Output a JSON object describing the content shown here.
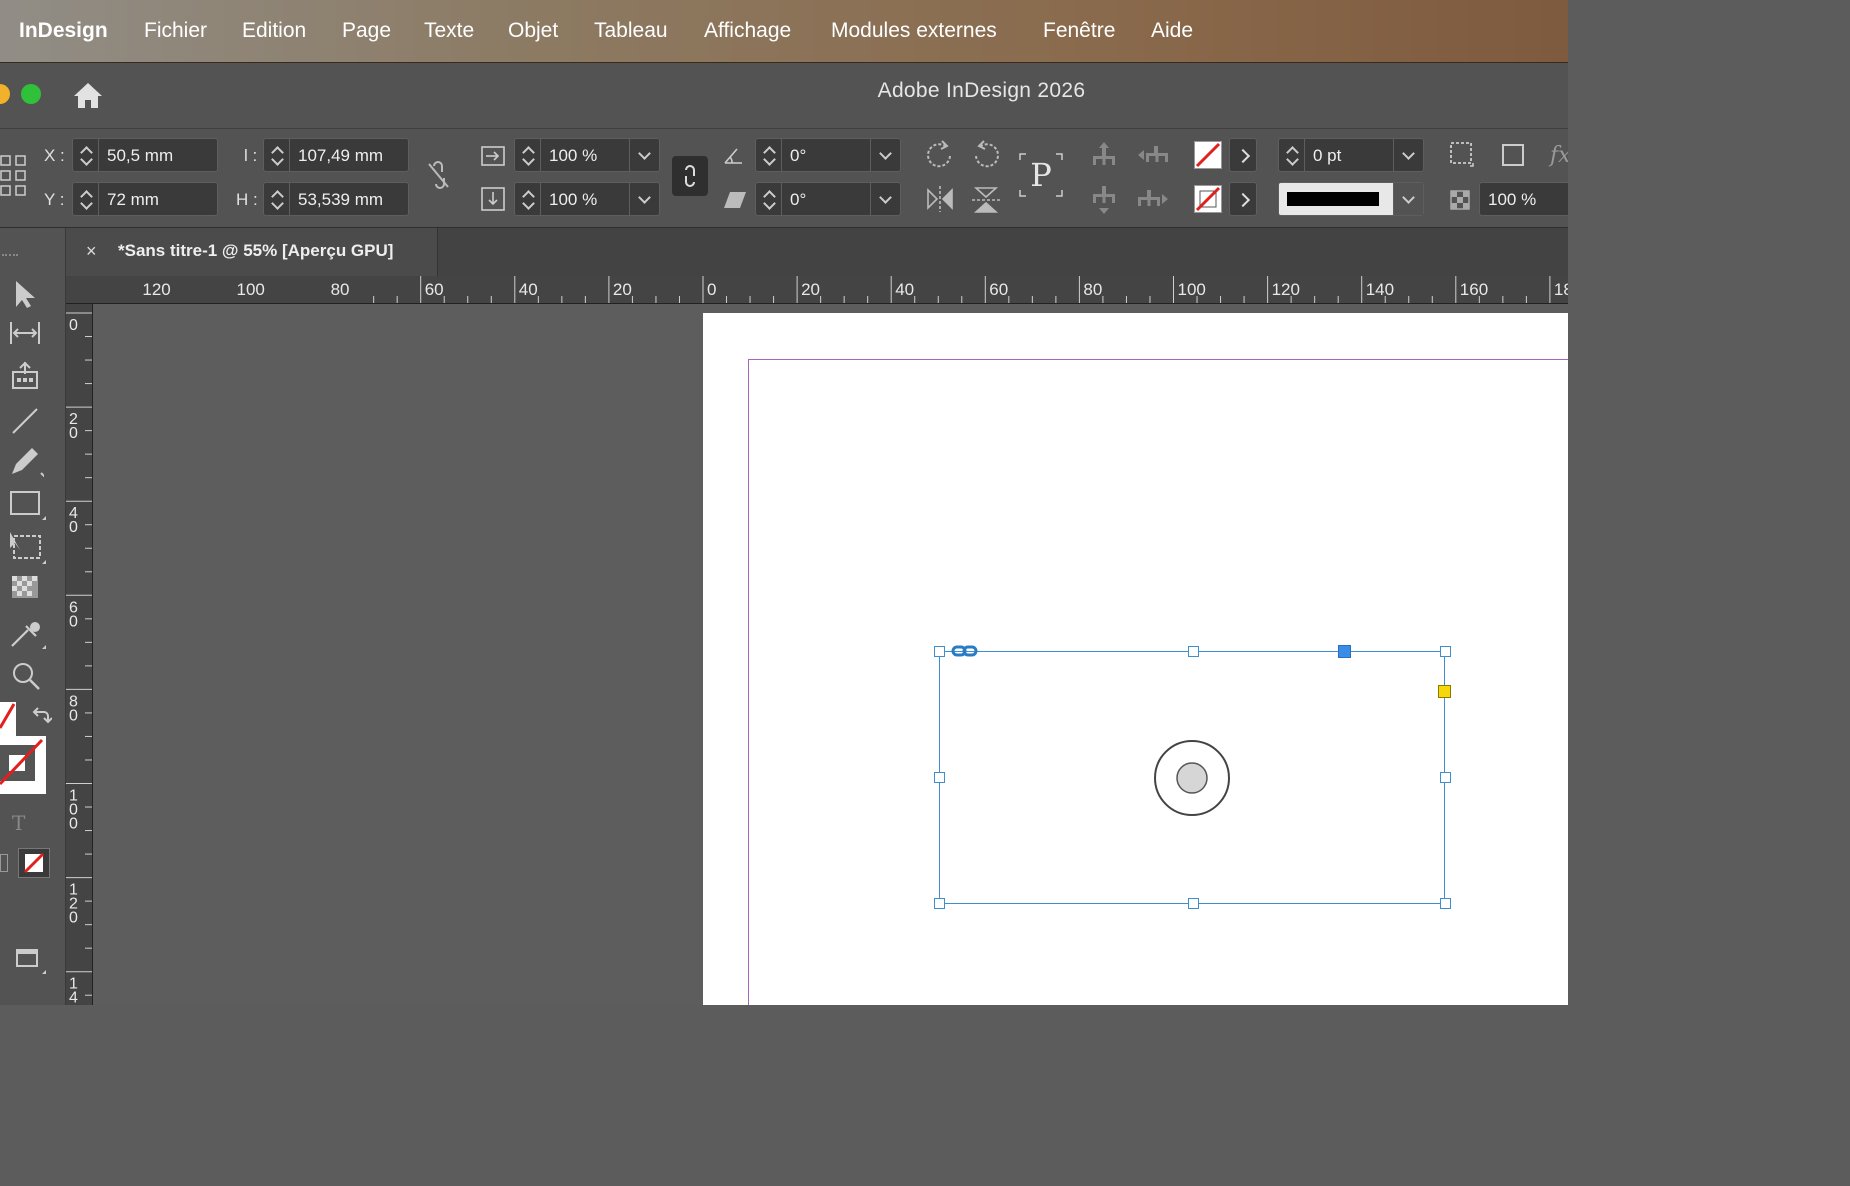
{
  "menubar": {
    "app": "InDesign",
    "items": [
      "Fichier",
      "Edition",
      "Page",
      "Texte",
      "Objet",
      "Tableau",
      "Affichage",
      "Modules externes",
      "Fenêtre",
      "Aide"
    ]
  },
  "window": {
    "title": "Adobe InDesign 2026"
  },
  "control": {
    "x_label": "X :",
    "x_value": "50,5 mm",
    "y_label": "Y :",
    "y_value": "72 mm",
    "w_label": "l :",
    "w_value": "107,49 mm",
    "h_label": "H :",
    "h_value": "53,539 mm",
    "scale_x": "100 %",
    "scale_y": "100 %",
    "rotate": "0°",
    "shear": "0°",
    "stroke_weight": "0 pt",
    "opacity": "100 %"
  },
  "document_tab": {
    "close": "×",
    "title": "*Sans titre-1 @ 55% [Aperçu GPU]"
  },
  "hruler": {
    "labels": [
      "120",
      "100",
      "80",
      "60",
      "40",
      "20",
      "0",
      "20",
      "40",
      "60",
      "80",
      "100",
      "120",
      "140",
      "160",
      "18"
    ]
  },
  "vruler": {
    "labels": [
      "0",
      "2\n0",
      "4\n0",
      "6\n0",
      "8\n0",
      "1\n0\n0",
      "1\n2\n0",
      "1\n4"
    ]
  },
  "colors": {
    "accent": "#3f8fcf",
    "margin": "#a667b8",
    "none_swatch": "#e0201f",
    "traffic_yellow": "#f2b12a",
    "traffic_green": "#30c13a"
  }
}
